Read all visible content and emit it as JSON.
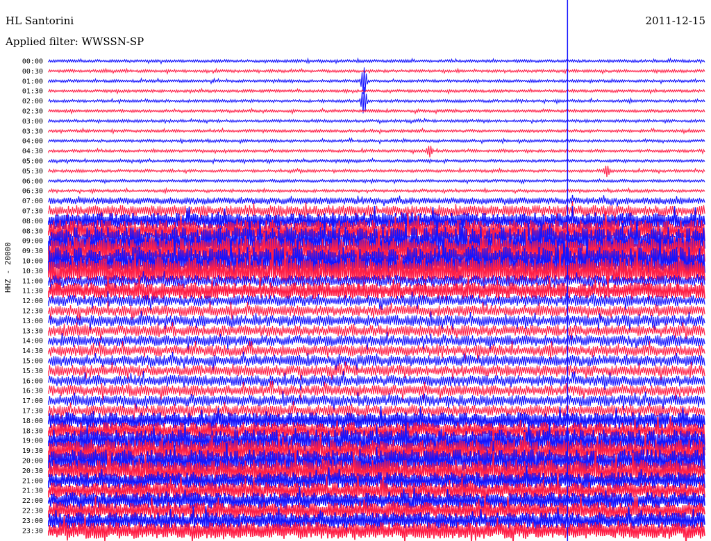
{
  "header": {
    "station": "HL Santorini",
    "date": "2011-12-15",
    "filter_label": "Applied filter: WWSSN-SP"
  },
  "side_label": "HHZ - 20000",
  "colors": {
    "trace_a": "#1414ff",
    "trace_b": "#ff1f47",
    "marker": "#1414ff",
    "background": "#ffffff"
  },
  "chart_data": {
    "type": "helicorder",
    "ylabel": "HHZ - 20000",
    "row_labels": [
      "00:00",
      "00:30",
      "01:00",
      "01:30",
      "02:00",
      "02:30",
      "03:00",
      "03:30",
      "04:00",
      "04:30",
      "05:00",
      "05:30",
      "06:00",
      "06:30",
      "07:00",
      "07:30",
      "08:00",
      "08:30",
      "09:00",
      "09:30",
      "10:00",
      "10:30",
      "11:00",
      "11:30",
      "12:00",
      "12:30",
      "13:00",
      "13:30",
      "14:00",
      "14:30",
      "15:00",
      "15:30",
      "16:00",
      "16:30",
      "17:00",
      "17:30",
      "18:00",
      "18:30",
      "19:00",
      "19:30",
      "20:00",
      "20:30",
      "21:00",
      "21:30",
      "22:00",
      "22:30",
      "23:00",
      "23:30"
    ],
    "row_colors": [
      "trace_a",
      "trace_b"
    ],
    "amplitude_level": [
      1,
      1,
      1,
      1,
      1,
      1,
      1,
      1,
      1,
      1,
      1,
      1,
      1,
      1,
      2,
      3,
      4,
      5,
      6,
      6,
      6,
      6,
      3,
      4,
      3,
      3,
      3,
      3,
      3,
      3,
      3,
      3,
      3,
      3,
      3,
      3,
      4,
      4,
      5,
      5,
      5,
      5,
      4,
      4,
      4,
      4,
      4,
      4
    ],
    "events": [
      {
        "row": "01:00",
        "time_fraction": 0.48,
        "strength": 5
      },
      {
        "row": "02:00",
        "time_fraction": 0.48,
        "strength": 5
      },
      {
        "row": "04:30",
        "time_fraction": 0.58,
        "strength": 2
      },
      {
        "row": "05:30",
        "time_fraction": 0.85,
        "strength": 2
      }
    ],
    "marker_time_fraction": 0.79
  }
}
